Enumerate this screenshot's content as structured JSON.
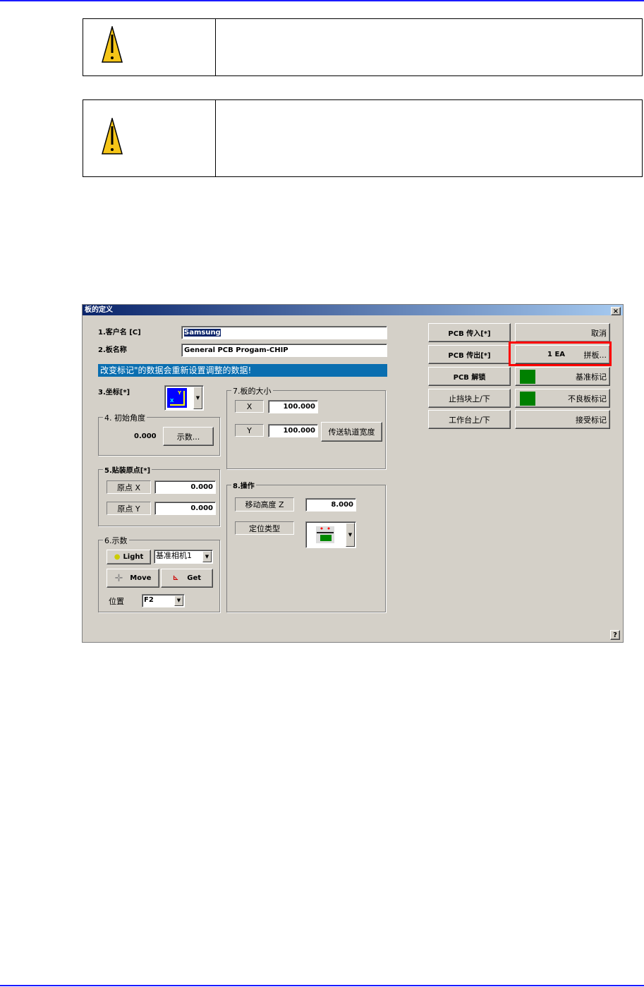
{
  "dialog": {
    "title": "板的定义",
    "customer_label": "1.客户名 [C]",
    "customer_value": "Samsung",
    "board_label": "2.板名称",
    "board_value": "General PCB Progam-CHIP",
    "banner": "改变标记\"的数据会重新设置调整的数据!",
    "coord_label": "3.坐标[*]",
    "angle": {
      "label": "4. 初始角度",
      "value": "0.000",
      "button": "示数..."
    },
    "origin": {
      "label": "5.贴装原点[*]",
      "x_label": "原点 X",
      "x_value": "0.000",
      "y_label": "原点 Y",
      "y_value": "0.000"
    },
    "teach": {
      "label": "6.示数",
      "light": "Light",
      "camera": "基准相机1",
      "move": "Move",
      "get": "Get",
      "pos_label": "位置",
      "pos_value": "F2"
    },
    "size": {
      "label": "7.板的大小",
      "x_label": "X",
      "x_value": "100.000",
      "y_label": "Y",
      "y_value": "100.000",
      "rail_button": "传送轨道宽度"
    },
    "op": {
      "label": "8.操作",
      "z_label": "移动高度 Z",
      "z_value": "8.000",
      "type_label": "定位类型"
    },
    "right": {
      "pcb_in": "PCB 传入[*]",
      "cancel": "取消",
      "pcb_out": "PCB 传出[*]",
      "array_count": "1 EA",
      "array": "拼板...",
      "pcb_unlock": "PCB 解锁",
      "fiducial": "基准标记",
      "stopper": "止挡块上/下",
      "bad_mark": "不良板标记",
      "table": "工作台上/下",
      "accept": "接受标记"
    },
    "help": "?",
    "close": "×",
    "accent": "#0a6eb0"
  }
}
